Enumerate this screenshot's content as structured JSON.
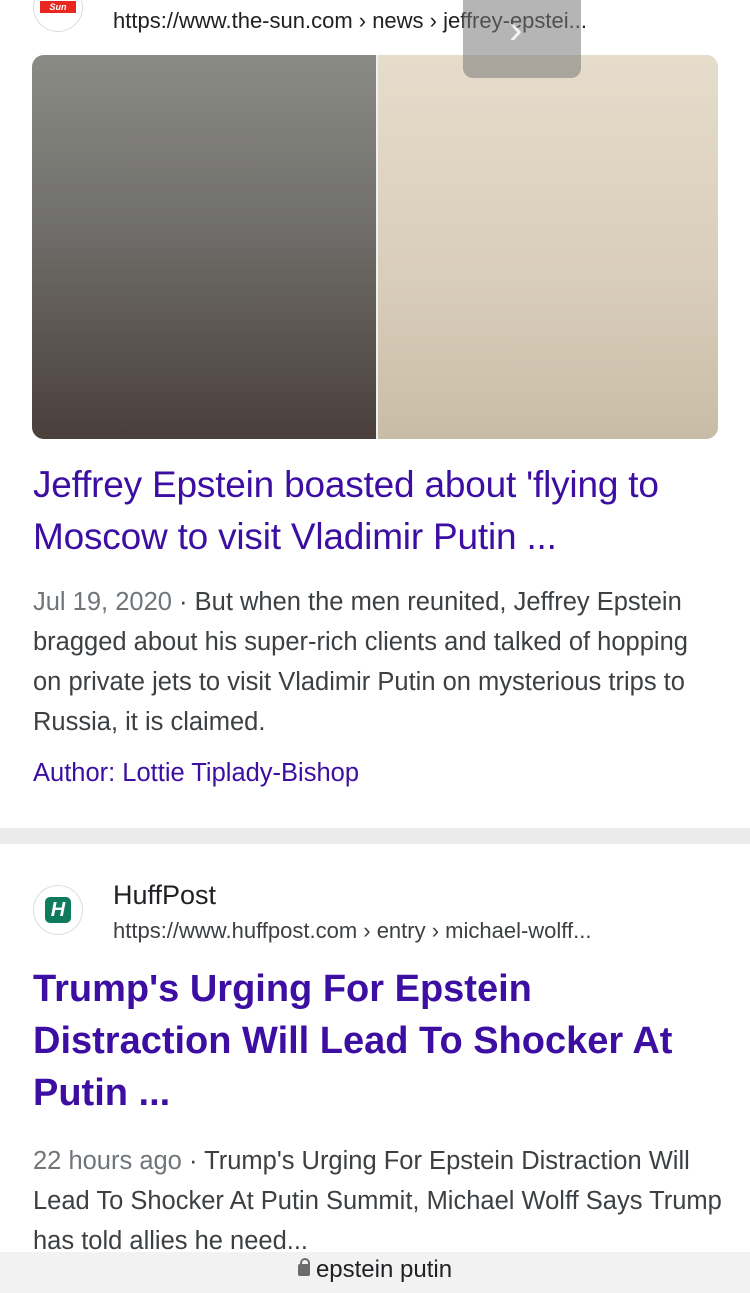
{
  "result1": {
    "favicon_label": "Sun",
    "url": "https://www.the-sun.com › news › jeffrey-epstei...",
    "image_alt": "Jeffrey Epstein and Vladimir Putin side by side",
    "title": "Jeffrey Epstein boasted about 'flying to Moscow to visit Vladimir Putin ...",
    "date": "Jul 19, 2020",
    "snippet": "But when the men reunited, Jeffrey Epstein bragged about his super-rich clients and talked of hopping on private jets to visit Vladimir Putin on mysterious trips to Russia, it is claimed.",
    "author": "Author: Lottie Tiplady-Bishop"
  },
  "result2": {
    "favicon_label": "H",
    "site_name": "HuffPost",
    "url": "https://www.huffpost.com › entry › michael-wolff...",
    "title": "Trump's Urging For Epstein Distraction Will Lead To Shocker At Putin ...",
    "date": "22 hours ago",
    "snippet": "Trump's Urging For Epstein Distraction Will Lead To Shocker At Putin Summit, Michael Wolff Says Trump has told allies he need..."
  },
  "bottom_bar": {
    "address": "epstein putin",
    "icon": "lock-icon"
  },
  "colors": {
    "link": "#3c0ea1",
    "text": "#3c4043",
    "date": "#70757a"
  }
}
